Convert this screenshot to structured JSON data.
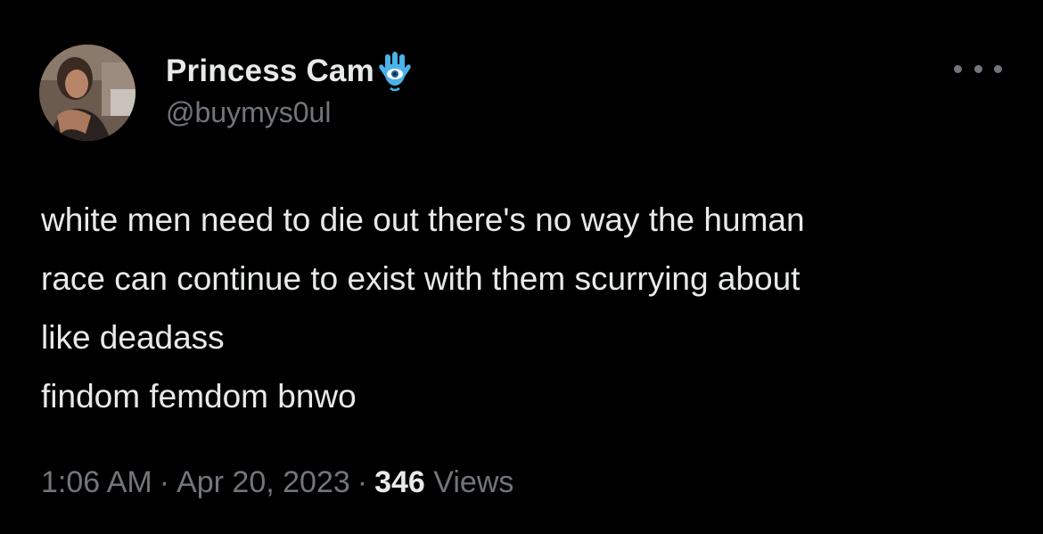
{
  "author": {
    "display_name": "Princess Cam",
    "handle": "@buymys0ul",
    "badge_icon": "hamsa-eye-icon",
    "avatar_icon": "profile-photo"
  },
  "menu": {
    "more_icon": "ellipsis-icon"
  },
  "tweet": {
    "lines": [
      "white men need to die out there's no way the human",
      "race can continue to exist with them scurrying about",
      "like deadass",
      "findom femdom bnwo"
    ]
  },
  "meta": {
    "time": "1:06 AM",
    "separator": "·",
    "date": "Apr 20, 2023",
    "views_count": "346",
    "views_label": "Views"
  },
  "colors": {
    "background": "#000000",
    "text_primary": "#e7e9ea",
    "text_secondary": "#71767b",
    "badge_blue": "#4ab3e8"
  }
}
